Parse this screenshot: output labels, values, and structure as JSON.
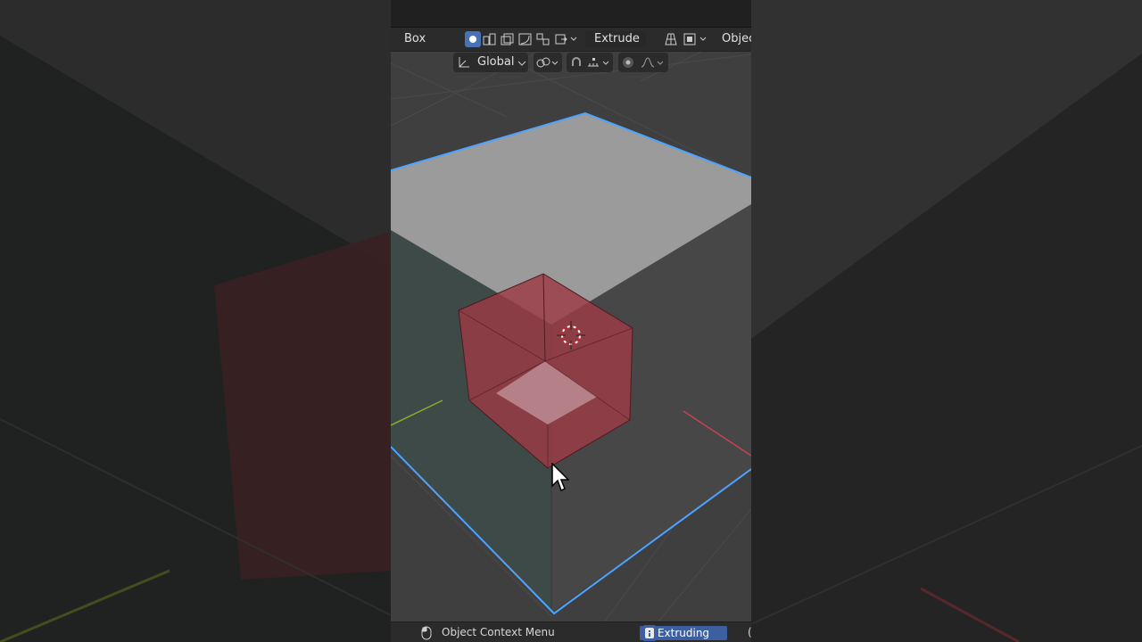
{
  "toolbar": {
    "mode_label": "Box",
    "operation_label": "Extrude",
    "object_menu_label": "Objec"
  },
  "header_row2": {
    "orientation_label": "Global"
  },
  "status_bar": {
    "context_menu_label": "Object Context Menu",
    "operation_status": "Extruding"
  },
  "colors": {
    "accent": "#4772b3",
    "selection_outline": "#4da3ff",
    "extrude_preview": "#a0323c",
    "x_axis": "#c8424f",
    "y_axis": "#8ab02a"
  },
  "icons": [
    "new-selection-icon",
    "extend-selection-icon",
    "subtract-selection-icon",
    "invert-selection-icon",
    "intersect-selection-icon",
    "operation-options-icon",
    "mesh-select-icon",
    "viewport-overlay-icon",
    "transform-orientation-icon",
    "pivot-point-icon",
    "snap-icon",
    "snap-target-icon",
    "proportional-edit-icon",
    "falloff-icon",
    "mouse-icon",
    "info-icon",
    "mouse-cursor-icon",
    "3d-cursor-icon"
  ]
}
